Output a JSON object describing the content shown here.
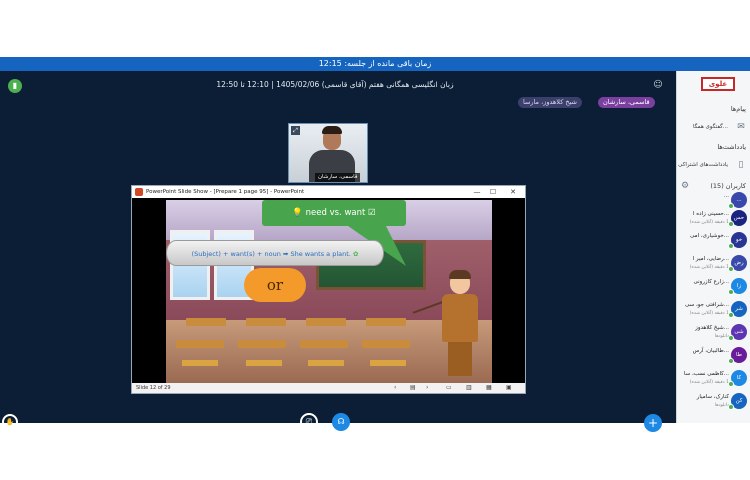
{
  "timer": {
    "text": "زمان باقی مانده از جلسه: 12:15"
  },
  "header": {
    "meeting_title": "زبان انگلیسی همگانی هفتم (آقای قاسمی) 1405/02/06 | 12:10 تا 12:50",
    "presenter": "قاسمی، سارشان",
    "talker": "شیخ کلاهدوز، مارسا"
  },
  "webcam": {
    "name": "قاسمی، سارشان"
  },
  "ppt": {
    "window_title": "PowerPoint Slide Show - [Prepare 1 page 95] - PowerPoint",
    "slide_status": "Slide 12 of 29",
    "bubble_text": "need vs. want",
    "scroll_text": "(Subject) + want(s) + noun ➡ She wants a plant.",
    "cloud_text": "or",
    "min_glyph": "—",
    "max_glyph": "☐",
    "close_glyph": "✕"
  },
  "sidebar": {
    "logo": "علوی",
    "messages_heading": "پیام‌ها",
    "public_chat": "گفتگوی همگا...",
    "notes_heading": "یادداشت‌ها",
    "shared_notes": "یادداشت‌های اشتراکی",
    "users_heading": "کاربران (15)",
    "users": [
      {
        "name": "...",
        "status": "",
        "avatar": "...",
        "color": "#3949ab"
      },
      {
        "name": "حسینی زاده ا...",
        "status": "(آنلاین شده) 1 دقیقه",
        "avatar": "حس",
        "color": "#1a237e"
      },
      {
        "name": "خوشیاری، امی...",
        "status": "",
        "avatar": "خو",
        "color": "#283593"
      },
      {
        "name": "رضایی، امیر ا...",
        "status": "(آنلاین شده) 1 دقیقه",
        "avatar": "رض",
        "color": "#3949ab"
      },
      {
        "name": "زارع کازرونی...",
        "status": "",
        "avatar": "زا",
        "color": "#1e88e5"
      },
      {
        "name": "شرافتی جو، سی...",
        "status": "(آنلاین شده) 1 دقیقه",
        "avatar": "شر",
        "color": "#1565c0"
      },
      {
        "name": "شیخ کلاهدوز...",
        "status": "دانلودها",
        "avatar": "شی",
        "color": "#5e35b1"
      },
      {
        "name": "طالبیان، آرس...",
        "status": "",
        "avatar": "طا",
        "color": "#6a1b9a"
      },
      {
        "name": "کاظمی نسب، سا...",
        "status": "(آنلاین شده) 1 دقیقه",
        "avatar": "کا",
        "color": "#1e88e5"
      },
      {
        "name": "کنارک، سامیار",
        "status": "دانلودها",
        "avatar": "کن",
        "color": "#1565c0"
      }
    ]
  },
  "colors": {
    "accent": "#1565c0",
    "background": "#0b1e35",
    "presenter_chip": "#7b3fa0",
    "bubble": "#49a54d",
    "cloud": "#f39a2b"
  },
  "icons": {
    "left_top": "bar-chart-icon",
    "user": "user-icon",
    "hand": "raise-hand-icon",
    "screen_share": "screen-share-icon",
    "headphones": "headphones-icon",
    "add": "plus-icon"
  }
}
